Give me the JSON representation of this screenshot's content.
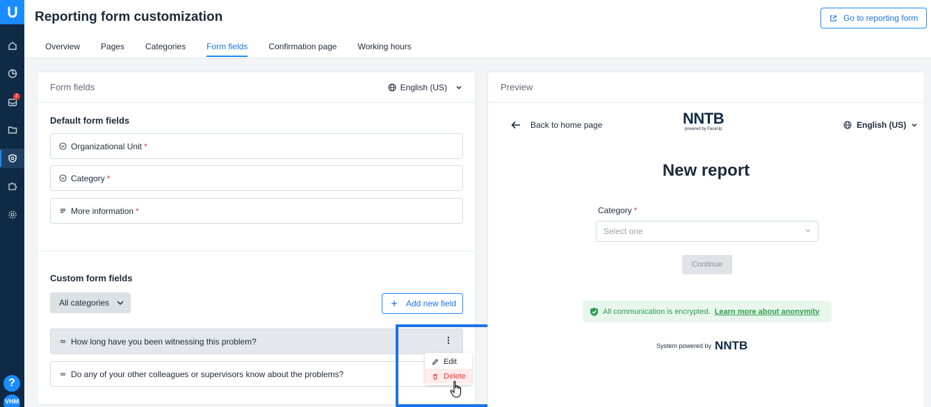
{
  "sidebar": {
    "badge_count": "2",
    "help": "?",
    "avatar": "VHM",
    "icons": [
      "home-icon",
      "chart-icon",
      "inbox-icon",
      "folder-icon",
      "shield-settings-icon",
      "puzzle-icon",
      "gear-icon"
    ]
  },
  "header": {
    "title": "Reporting form customization",
    "goto_button": "Go to reporting form",
    "tabs": [
      "Overview",
      "Pages",
      "Categories",
      "Form fields",
      "Confirmation page",
      "Working hours"
    ],
    "active_tab": "Form fields"
  },
  "form_fields": {
    "panel_title": "Form fields",
    "language": "English (US)",
    "default_title": "Default form fields",
    "default_fields": [
      {
        "label": "Organizational Unit",
        "required": "*",
        "icon": "dropdown-circle-icon"
      },
      {
        "label": "Category",
        "required": "*",
        "icon": "dropdown-circle-icon"
      },
      {
        "label": "More information",
        "required": "*",
        "icon": "text-lines-icon"
      }
    ],
    "custom_title": "Custom form fields",
    "filter_label": "All categories",
    "add_field_label": "Add new field",
    "custom_fields": [
      {
        "label": "How long have you been witnessing this problem?"
      },
      {
        "label": "Do any of your other colleagues or supervisors know about the problems?"
      }
    ],
    "context_menu": {
      "edit": "Edit",
      "delete": "Delete"
    }
  },
  "preview": {
    "panel_title": "Preview",
    "back_label": "Back to home page",
    "logo_text": "NNTB",
    "logo_sub": "powered by FaceUp",
    "language": "English (US)",
    "heading": "New report",
    "category_label": "Category",
    "required": "*",
    "select_placeholder": "Select one",
    "continue_label": "Continue",
    "encrypted_text": "All communication is encrypted.",
    "encrypted_link": "Learn more about anonymity",
    "powered_by": "System powered by",
    "powered_logo": "NNTB"
  },
  "colors": {
    "accent": "#1a8cff",
    "sidebar": "#0f2a44",
    "danger": "#e53935",
    "success": "#2e9e4f"
  }
}
